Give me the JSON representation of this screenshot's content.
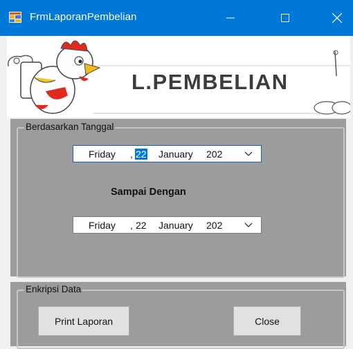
{
  "window": {
    "title": "FrmLaporanPembelian",
    "accent_color": "#0078d7",
    "icons": {
      "app": "form-app-icon",
      "minimize": "minimize-icon",
      "maximize": "maximize-icon",
      "close": "close-icon"
    }
  },
  "banner": {
    "title": "L.PEMBELIAN",
    "image": "cartoon-chicken-chef-holding-plate"
  },
  "date_section": {
    "legend": "Berdasarkan Tanggal",
    "start_date": {
      "day": "Friday",
      "sep": ",",
      "date": "22",
      "month": "January",
      "year": "202"
    },
    "middle_label": "Sampai Dengan",
    "end_date": {
      "day": "Friday",
      "sep": ",",
      "date": "22",
      "month": "January",
      "year": "202"
    }
  },
  "action_section": {
    "legend": "Enkripsi Data",
    "print_label": "Print Laporan",
    "close_label": "Close"
  }
}
